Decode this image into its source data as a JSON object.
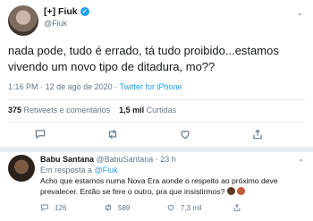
{
  "main_tweet": {
    "author_name": "[+] Fiuk",
    "author_handle": "@Fiuk",
    "text": "nada pode, tudo é errado, tá tudo proibido...estamos vivendo um novo tipo de ditadura, mo??",
    "time": "1:16 PM",
    "date": "12 de ago de 2020",
    "separator": "·",
    "source": "Twitter for iPhone",
    "retweets_count": "375",
    "retweets_label": "Retweets e comentários",
    "likes_count": "1,5 mil",
    "likes_label": "Curtidas",
    "icons": [
      "reply-icon",
      "retweet-icon",
      "like-icon",
      "share-icon"
    ]
  },
  "reply_tweet": {
    "author_name": "Babu Santana",
    "author_handle": "@BabuSantana",
    "time": "23 h",
    "separator": "·",
    "reply_prefix": "Em resposta a",
    "reply_to": "@Fiuk",
    "text": "Acho que estamos numa Nova Era aonde o respeito ao próximo deve prevalecer. Então se fere o outro, pra que insistirmos?",
    "replies": "126",
    "retweets": "589",
    "likes": "7,3 mil"
  },
  "colors": {
    "accent": "#1da1f2",
    "secondary_text": "#657786",
    "divider": "#e6ecf0"
  }
}
